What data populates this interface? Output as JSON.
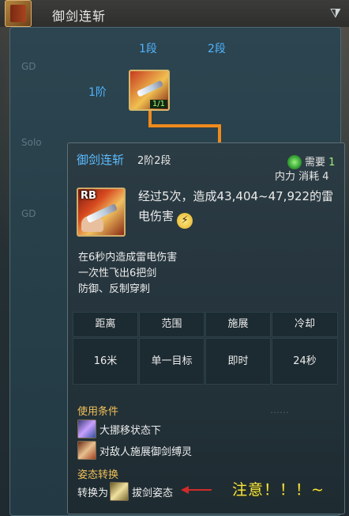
{
  "window": {
    "title": "御剑连斩",
    "filter_icon": "filter-icon"
  },
  "tree": {
    "stage_headers": [
      "1段",
      "2段"
    ],
    "tier_label": "1阶",
    "node_count": "1/1"
  },
  "tooltip": {
    "name": "御剑连斩",
    "level": "2阶2段",
    "requirement_label": "需要",
    "requirement_value": "1",
    "cost": "内力 消耗 4",
    "icon_badge": "RB",
    "description": "经过5次，造成43,404~47,922的雷电伤害",
    "effects": [
      "在6秒内造成雷电伤害",
      "一次性飞出6把剑",
      "防御、反制穿刺"
    ],
    "stats": {
      "headers": [
        "距离",
        "范围",
        "施展",
        "冷却"
      ],
      "values": [
        "16米",
        "单一目标",
        "即时",
        "24秒"
      ]
    },
    "conditions_title": "使用条件",
    "conditions": [
      "大挪移状态下",
      "对敌人施展御剑缚灵"
    ],
    "stance_title": "姿态转换",
    "stance_prefix": "转换为",
    "stance_target": "拔剑姿态"
  },
  "annotation": {
    "note": "注意！！！~"
  },
  "colors": {
    "accent_blue": "#4fb4ff",
    "gold": "#f0c058",
    "connector": "#f08a1c",
    "note_yellow": "#f6e64a",
    "arrow_red": "#d22a2a"
  }
}
